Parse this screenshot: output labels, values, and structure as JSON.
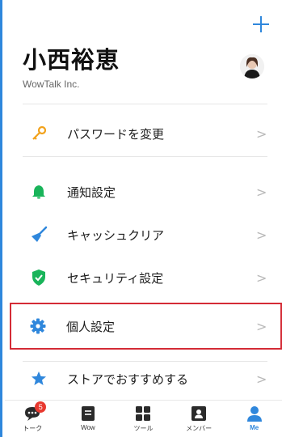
{
  "header": {
    "add_icon": "plus-icon"
  },
  "profile": {
    "name": "小西裕恵",
    "company": "WowTalk Inc."
  },
  "menu": {
    "items": [
      {
        "label": "パスワードを変更",
        "icon": "key-icon",
        "color": "#f2a21b"
      },
      {
        "label": "通知設定",
        "icon": "bell-icon",
        "color": "#19b45a"
      },
      {
        "label": "キャッシュクリア",
        "icon": "broom-icon",
        "color": "#2f87dc"
      },
      {
        "label": "セキュリティ設定",
        "icon": "shield-check-icon",
        "color": "#19b45a"
      },
      {
        "label": "個人設定",
        "icon": "gear-icon",
        "color": "#2f87dc"
      },
      {
        "label": "ストアでおすすめする",
        "icon": "star-icon",
        "color": "#2f87dc"
      }
    ],
    "chevron": ">"
  },
  "tabbar": {
    "tabs": [
      {
        "label": "トーク",
        "icon": "chat-bubble-icon",
        "badge": "5"
      },
      {
        "label": "Wow",
        "icon": "document-icon"
      },
      {
        "label": "ツール",
        "icon": "grid-icon"
      },
      {
        "label": "メンバー",
        "icon": "contact-card-icon"
      },
      {
        "label": "Me",
        "icon": "person-icon",
        "active": true
      }
    ]
  },
  "colors": {
    "accent": "#2f87dc",
    "highlight": "#d42b36",
    "badge": "#e8392f"
  }
}
